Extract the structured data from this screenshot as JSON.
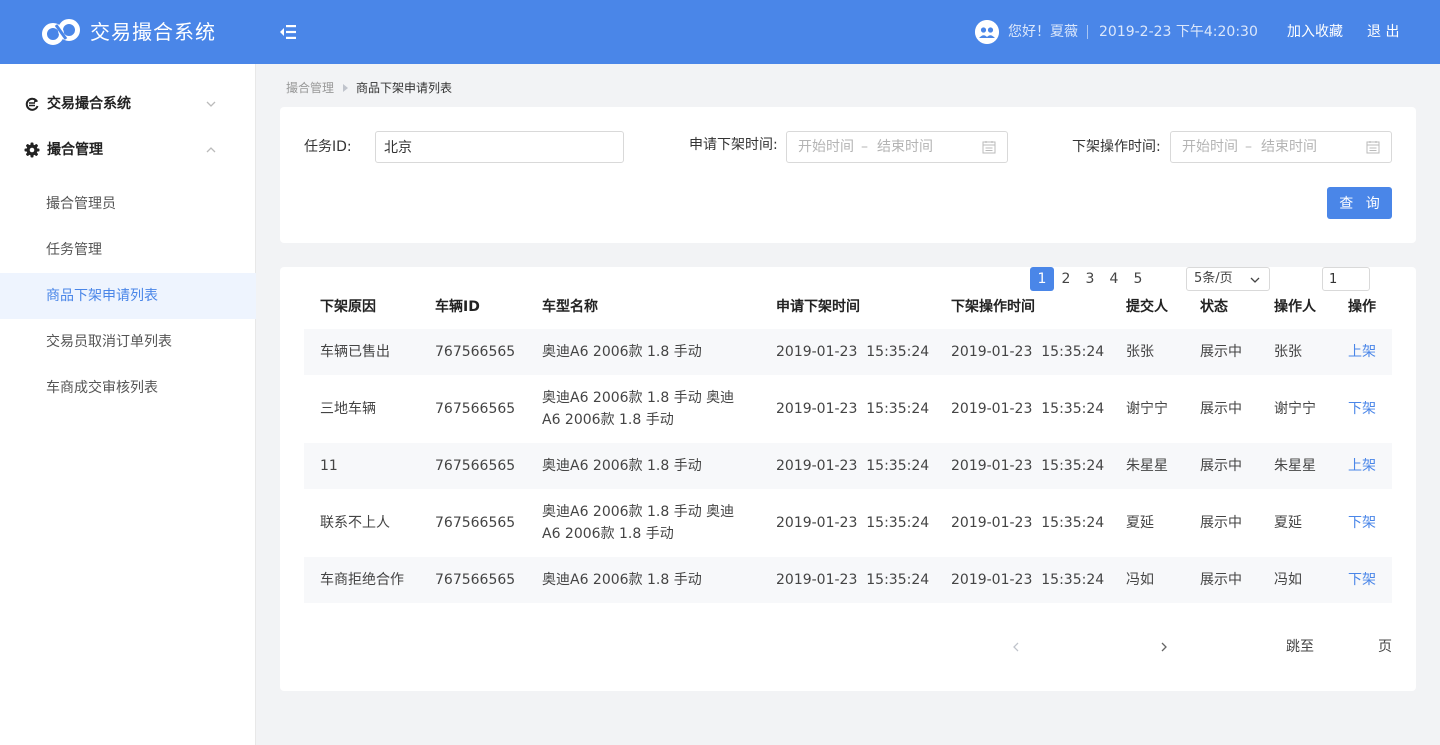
{
  "header": {
    "title": "交易撮合系统",
    "greeting": "您好！夏薇",
    "datetime": "2019-2-23 下午4:20:30",
    "add_favorite": "加入收藏",
    "logout": "退 出",
    "color": "#4a86e8"
  },
  "sidebar": {
    "groups": [
      {
        "label": "交易撮合系统",
        "icon": "refresh-icon",
        "expanded": false
      },
      {
        "label": "撮合管理",
        "icon": "gear-icon",
        "expanded": true
      }
    ],
    "items": [
      {
        "label": "撮合管理员"
      },
      {
        "label": "任务管理"
      },
      {
        "label": "商品下架申请列表",
        "active": true
      },
      {
        "label": "交易员取消订单列表"
      },
      {
        "label": "车商成交审核列表"
      }
    ]
  },
  "breadcrumb": {
    "parent": "撮合管理",
    "current": "商品下架申请列表"
  },
  "filters": {
    "task_id_label": "任务ID:",
    "task_id_value": "北京",
    "apply_time_label": "申请下架时间:",
    "op_time_label": "下架操作时间:",
    "start_placeholder": "开始时间",
    "end_placeholder": "结束时间",
    "range_sep": "–",
    "query_button": "查 询"
  },
  "table": {
    "columns": [
      "下架原因",
      "车辆ID",
      "车型名称",
      "申请下架时间",
      "下架操作时间",
      "提交人",
      "状态",
      "操作人",
      "操作"
    ],
    "rows": [
      {
        "reason": "车辆已售出",
        "vehicle_id": "767566565",
        "model": [
          "奥迪A6 2006款 1.8 手动"
        ],
        "apply_time": "2019-01-23  15:35:24",
        "op_time": "2019-01-23  15:35:24",
        "submitter": "张张",
        "status": "展示中",
        "operator": "张张",
        "action": "上架"
      },
      {
        "reason": "三地车辆",
        "vehicle_id": "767566565",
        "model": [
          "奥迪A6 2006款 1.8 手动 奥迪",
          "A6 2006款 1.8 手动"
        ],
        "apply_time": "2019-01-23  15:35:24",
        "op_time": "2019-01-23  15:35:24",
        "submitter": "谢宁宁",
        "status": "展示中",
        "operator": "谢宁宁",
        "action": "下架"
      },
      {
        "reason": "11",
        "vehicle_id": "767566565",
        "model": [
          "奥迪A6 2006款 1.8 手动"
        ],
        "apply_time": "2019-01-23  15:35:24",
        "op_time": "2019-01-23  15:35:24",
        "submitter": "朱星星",
        "status": "展示中",
        "operator": "朱星星",
        "action": "上架"
      },
      {
        "reason": "联系不上人",
        "vehicle_id": "767566565",
        "model": [
          "奥迪A6 2006款 1.8 手动 奥迪",
          "A6 2006款 1.8 手动"
        ],
        "apply_time": "2019-01-23  15:35:24",
        "op_time": "2019-01-23  15:35:24",
        "submitter": "夏延",
        "status": "展示中",
        "operator": "夏延",
        "action": "下架"
      },
      {
        "reason": "车商拒绝合作",
        "vehicle_id": "767566565",
        "model": [
          "奥迪A6 2006款 1.8 手动"
        ],
        "apply_time": "2019-01-23  15:35:24",
        "op_time": "2019-01-23  15:35:24",
        "submitter": "冯如",
        "status": "展示中",
        "operator": "冯如",
        "action": "下架"
      }
    ]
  },
  "pagination": {
    "pages": [
      "1",
      "2",
      "3",
      "4",
      "5"
    ],
    "current": "1",
    "page_size": "5条/页",
    "jump_label": "跳至",
    "jump_value": "1",
    "page_suffix": "页"
  }
}
